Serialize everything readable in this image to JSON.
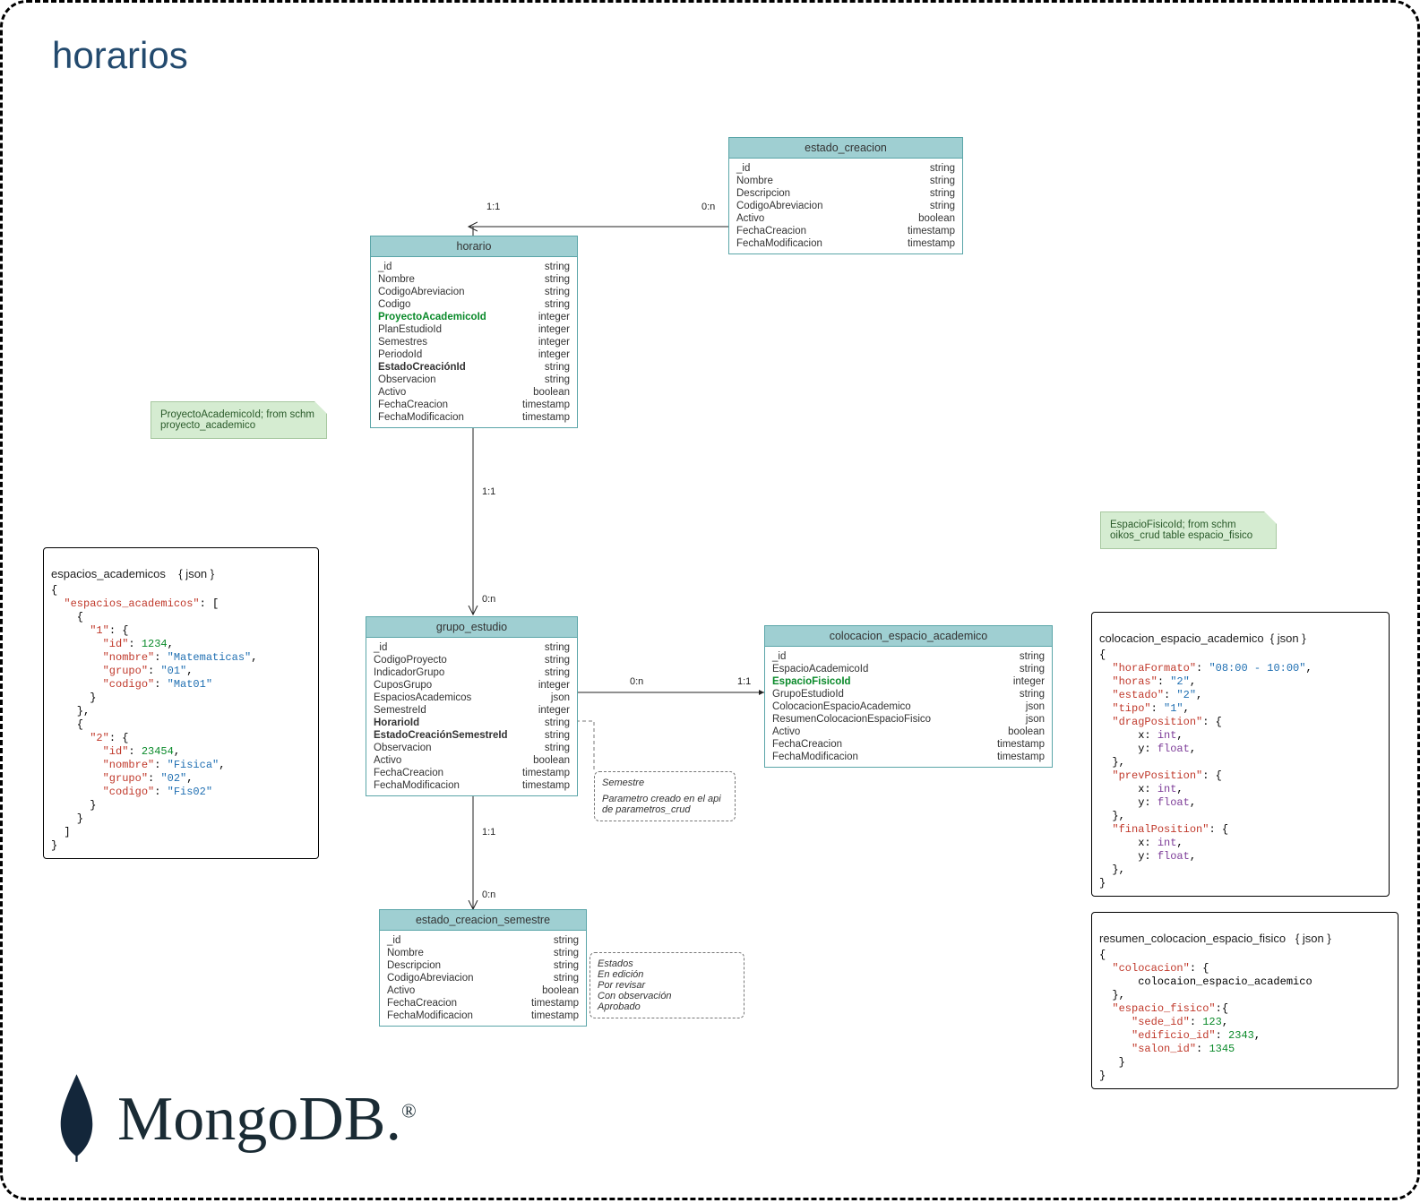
{
  "page": {
    "title": "horarios"
  },
  "entities": {
    "estado_creacion": {
      "title": "estado_creacion",
      "fields": [
        {
          "name": "_id",
          "type": "string"
        },
        {
          "name": "Nombre",
          "type": "string"
        },
        {
          "name": "Descripcion",
          "type": "string"
        },
        {
          "name": "CodigoAbreviacion",
          "type": "string"
        },
        {
          "name": "Activo",
          "type": "boolean"
        },
        {
          "name": "FechaCreacion",
          "type": "timestamp"
        },
        {
          "name": "FechaModificacion",
          "type": "timestamp"
        }
      ]
    },
    "horario": {
      "title": "horario",
      "fields": [
        {
          "name": "_id",
          "type": "string"
        },
        {
          "name": "Nombre",
          "type": "string"
        },
        {
          "name": "CodigoAbreviacion",
          "type": "string"
        },
        {
          "name": "Codigo",
          "type": "string"
        },
        {
          "name": "ProyectoAcademicoId",
          "type": "integer",
          "style": "green"
        },
        {
          "name": "PlanEstudioId",
          "type": "integer"
        },
        {
          "name": "Semestres",
          "type": "integer"
        },
        {
          "name": "PeriodoId",
          "type": "integer"
        },
        {
          "name": "EstadoCreaciónId",
          "type": "string",
          "style": "bold"
        },
        {
          "name": "Observacion",
          "type": "string"
        },
        {
          "name": "Activo",
          "type": "boolean"
        },
        {
          "name": "FechaCreacion",
          "type": "timestamp"
        },
        {
          "name": "FechaModificacion",
          "type": "timestamp"
        }
      ]
    },
    "grupo_estudio": {
      "title": "grupo_estudio",
      "fields": [
        {
          "name": "_id",
          "type": "string"
        },
        {
          "name": "CodigoProyecto",
          "type": "string"
        },
        {
          "name": "IndicadorGrupo",
          "type": "string"
        },
        {
          "name": "CuposGrupo",
          "type": "integer"
        },
        {
          "name": "EspaciosAcademicos",
          "type": "json"
        },
        {
          "name": "SemestreId",
          "type": "integer"
        },
        {
          "name": "HorarioId",
          "type": "string",
          "style": "bold"
        },
        {
          "name": "EstadoCreaciónSemestreId",
          "type": "string",
          "style": "bold"
        },
        {
          "name": "Observacion",
          "type": "string"
        },
        {
          "name": "Activo",
          "type": "boolean"
        },
        {
          "name": "FechaCreacion",
          "type": "timestamp"
        },
        {
          "name": "FechaModificacion",
          "type": "timestamp"
        }
      ]
    },
    "colocacion_espacio_academico": {
      "title": "colocacion_espacio_academico",
      "fields": [
        {
          "name": "_id",
          "type": "string"
        },
        {
          "name": "EspacioAcademicoId",
          "type": "string"
        },
        {
          "name": "EspacioFisicoId",
          "type": "integer",
          "style": "green"
        },
        {
          "name": "GrupoEstudioId",
          "type": "string"
        },
        {
          "name": "ColocacionEspacioAcademico",
          "type": "json"
        },
        {
          "name": "ResumenColocacionEspacioFisico",
          "type": "json"
        },
        {
          "name": "Activo",
          "type": "boolean"
        },
        {
          "name": "FechaCreacion",
          "type": "timestamp"
        },
        {
          "name": "FechaModificacion",
          "type": "timestamp"
        }
      ]
    },
    "estado_creacion_semestre": {
      "title": "estado_creacion_semestre",
      "fields": [
        {
          "name": "_id",
          "type": "string"
        },
        {
          "name": "Nombre",
          "type": "string"
        },
        {
          "name": "Descripcion",
          "type": "string"
        },
        {
          "name": "CodigoAbreviacion",
          "type": "string"
        },
        {
          "name": "Activo",
          "type": "boolean"
        },
        {
          "name": "FechaCreacion",
          "type": "timestamp"
        },
        {
          "name": "FechaModificacion",
          "type": "timestamp"
        }
      ]
    }
  },
  "notes": {
    "proyecto": "ProyectoAcademicoId; from schm proyecto_academico",
    "espacio_fisico": "EspacioFisicoId; from schm oikos_crud table espacio_fisico",
    "semestre_title": "Semestre",
    "semestre_body": "Parametro creado en el api de parametros_crud",
    "estados_title": "Estados",
    "estados_list": [
      "En edición",
      "Por revisar",
      "Con observación",
      "Aprobado"
    ]
  },
  "jsonboxes": {
    "espacios_academicos": {
      "title": "espacios_academicos    { json }"
    },
    "colocacion": {
      "title": "colocacion_espacio_academico  { json }"
    },
    "resumen": {
      "title": "resumen_colocacion_espacio_fisico   { json }"
    }
  },
  "cardinalities": {
    "h_ec_left": "1:1",
    "h_ec_right": "0:n",
    "h_ge_top": "1:1",
    "h_ge_bot": "0:n",
    "ge_col_left": "0:n",
    "ge_col_right": "1:1",
    "ge_ecs_top": "1:1",
    "ge_ecs_bot": "0:n"
  },
  "logo": {
    "text": "MongoDB.",
    "r": "®"
  }
}
